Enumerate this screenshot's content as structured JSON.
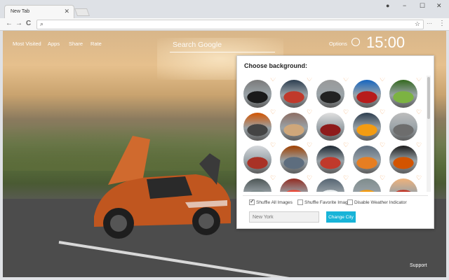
{
  "browser": {
    "tab_title": "New Tab",
    "tab_close": "✕",
    "window_controls": [
      "−",
      "☐",
      "✕"
    ],
    "back_glyph": "←",
    "forward_glyph": "→",
    "reload_glyph": "C",
    "more_glyph": "⋮"
  },
  "page": {
    "nav_links": [
      "Most Visited",
      "Apps",
      "Share",
      "Rate"
    ],
    "search_placeholder": "Search Google",
    "options_label": "Options",
    "clock": "15:00",
    "support_label": "Support"
  },
  "panel": {
    "title": "Choose background:",
    "shuffle_all": "Shuffle All Images",
    "shuffle_favorite": "Shuffle Favorite Images",
    "disable_weather": "Disable Weather Indicator",
    "city_value": "New York",
    "change_city": "Change City",
    "shuffle_all_checked": true,
    "shuffle_favorite_checked": false,
    "disable_weather_checked": false
  },
  "colors": {
    "accent": "#18b4d8",
    "heart": "#f2a25a"
  }
}
